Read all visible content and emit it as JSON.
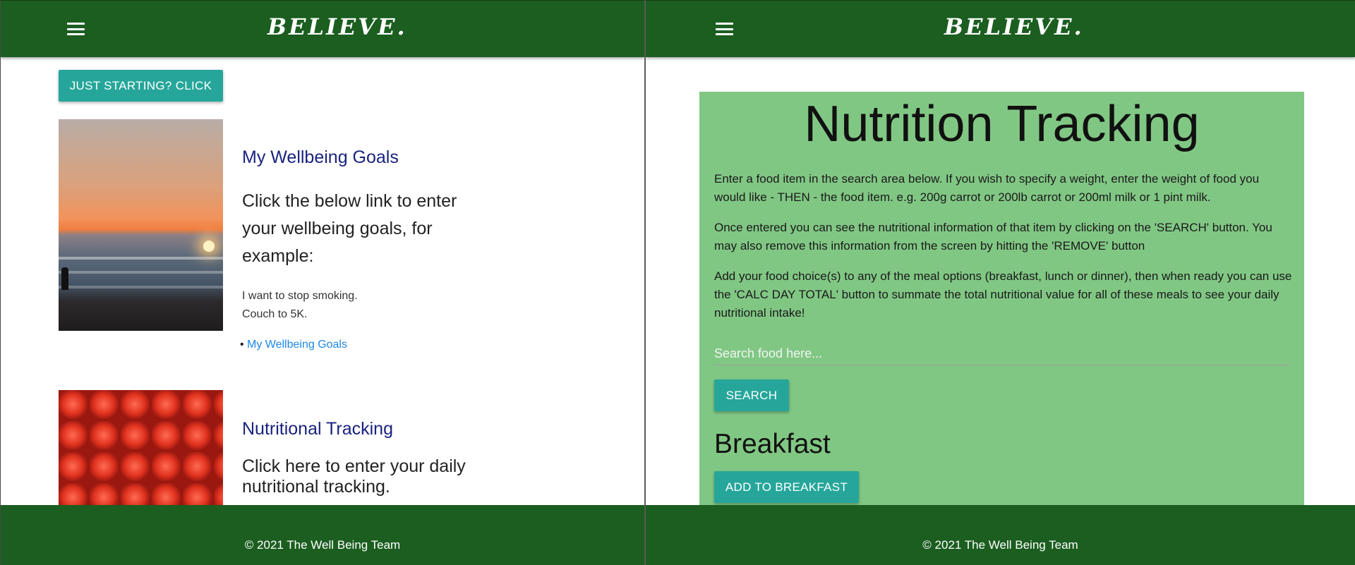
{
  "left": {
    "brand": "BELIEVE.",
    "start_button": "JUST STARTING? CLICK",
    "card1": {
      "title": "My Wellbeing Goals",
      "body": "Click the below link to enter your wellbeing goals, for example:",
      "examples": [
        "I want to stop smoking.",
        "Couch to 5K."
      ],
      "link": "My Wellbeing Goals"
    },
    "card2": {
      "title": "Nutritional Tracking",
      "body": "Click here to enter your daily nutritional tracking."
    },
    "footer": "© 2021 The Well Being Team"
  },
  "right": {
    "brand": "BELIEVE.",
    "title": "Nutrition Tracking",
    "paragraphs": [
      "Enter a food item in the search area below. If you wish to specify a weight, enter the weight of food you would like - THEN - the food item. e.g. 200g carrot or 200lb carrot or 200ml milk or 1 pint milk.",
      "Once entered you can see the nutritional information of that item by clicking on the 'SEARCH' button. You may also remove this information from the screen by hitting the 'REMOVE' button",
      "Add your food choice(s) to any of the meal options (breakfast, lunch or dinner), then when ready you can use the 'CALC DAY TOTAL' button to summate the total nutritional value for all of these meals to see your daily nutritional intake!"
    ],
    "search_placeholder": "Search food here...",
    "search_value": "",
    "search_button": "SEARCH",
    "breakfast_heading": "Breakfast",
    "add_breakfast_button": "ADD TO BREAKFAST",
    "footer": "© 2021 The Well Being Team"
  },
  "icons": {
    "menu": "hamburger-menu-icon"
  },
  "colors": {
    "header_footer": "#1b5e20",
    "button": "#26a69a",
    "panel": "#81c784",
    "card_title": "#1a237e",
    "link": "#1e88e5"
  }
}
